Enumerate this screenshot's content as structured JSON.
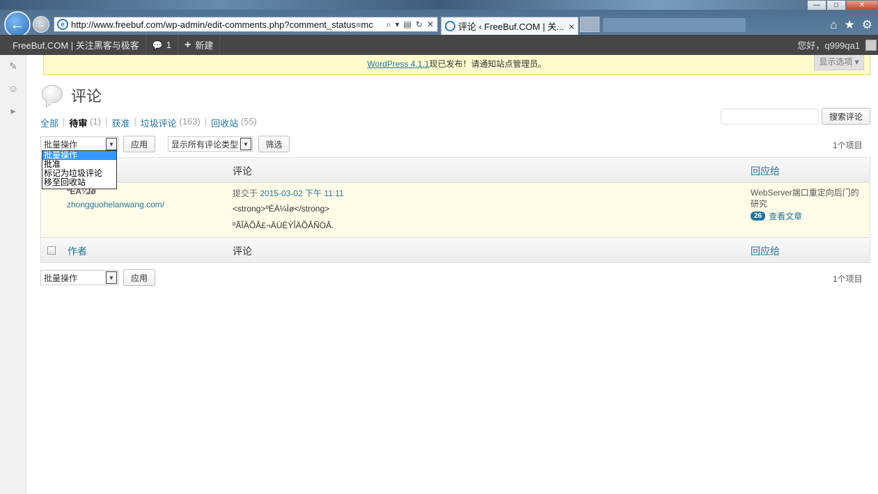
{
  "browser": {
    "url": "http://www.freebuf.com/wp-admin/edit-comments.php?comment_status=mc",
    "tab_title": "评论 ‹ FreeBuf.COM | 关...",
    "tab_close": "×",
    "back_glyph": "←",
    "forward_glyph": "→",
    "favicon_glyph": "e",
    "win_minimize": "—",
    "win_maximize": "□",
    "win_close": "✕",
    "addr_search_glyph": "⌕",
    "addr_dropdown_glyph": "▾",
    "addr_compat_glyph": "▤",
    "addr_refresh_glyph": "↻",
    "addr_stop_glyph": "✕",
    "home_glyph": "⌂",
    "star_glyph": "★",
    "gear_glyph": "⚙"
  },
  "adminbar": {
    "site_name": "FreeBuf.COM | 关注黑客与极客",
    "comments_icon": "💬",
    "comments_count": "1",
    "new_icon": "+",
    "new_label": "新建",
    "greeting": "您好，q999qa1",
    "avatar_glyph": "·"
  },
  "sidemenu": {
    "pin_glyph": "✎",
    "users_glyph": "☺",
    "collapse_glyph": "▸"
  },
  "notice": {
    "link_text": "WordPress 4.1.1",
    "text": "现已发布！请通知站点管理员。"
  },
  "screen_options": "显示选项 ▾",
  "page": {
    "title": "评论"
  },
  "filters": {
    "all_label": "全部",
    "pending_label": "待审",
    "pending_count": "(1)",
    "approved_label": "获准",
    "spam_label": "垃圾评论",
    "spam_count": "(163)",
    "trash_label": "回收站",
    "trash_count": "(55)"
  },
  "search": {
    "button": "搜索评论"
  },
  "bulk_top": {
    "selected": "批量操作",
    "apply": "应用",
    "type_selected": "显示所有评论类型",
    "filter": "筛选",
    "items_count": "1个项目",
    "arrow_glyph": "▼"
  },
  "bulk_dropdown": {
    "options": [
      "批量操作",
      "批准",
      "标记为垃圾评论",
      "移至回收站"
    ]
  },
  "table": {
    "col_comment": "评论",
    "col_author": "作者",
    "col_response": "回应给",
    "row": {
      "author_name": "ºÉÀ¼Ìø",
      "author_url": "zhongguohelanwang.com/",
      "submitted_prefix": "提交于",
      "submitted_date": "2015-03-02 下午 11:11",
      "line1": "<strong>ºÉÀ¼Ìø</strong>",
      "line2": "ºÃÎÄÕÂ£¬ÄÚÈÝÎÄÕÂÑÓÂ.",
      "response_title": "WebServer端口重定向后门的研究",
      "response_count": "26",
      "response_link": "查看文章"
    }
  },
  "bulk_bottom": {
    "selected": "批量操作",
    "apply": "应用",
    "items_count": "1个项目"
  }
}
